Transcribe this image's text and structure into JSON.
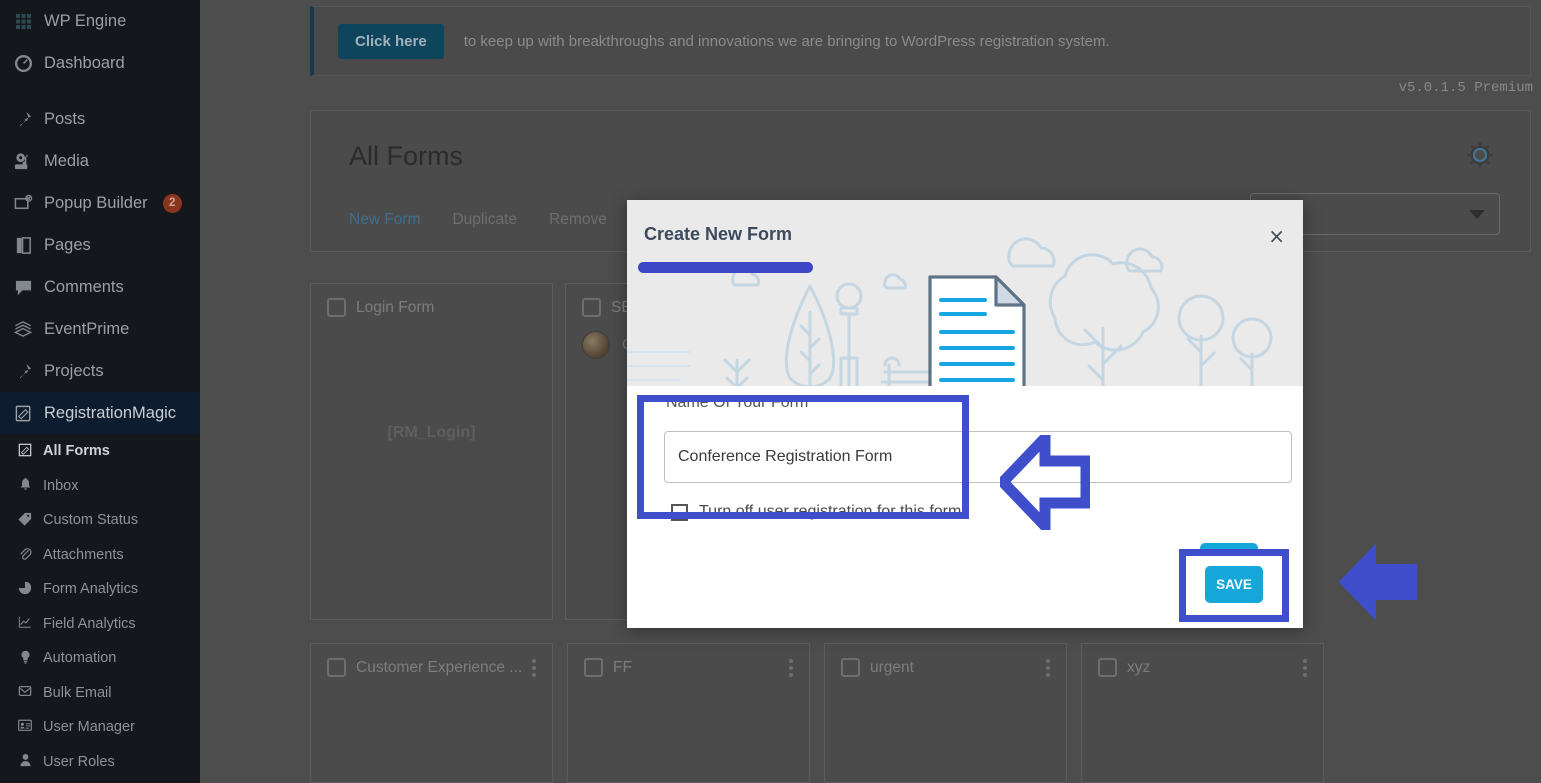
{
  "sidebar": {
    "items": [
      {
        "label": "WP Engine",
        "icon": "wpengine-icon"
      },
      {
        "label": "Dashboard",
        "icon": "dashboard-icon",
        "gap_after": true
      },
      {
        "label": "Posts",
        "icon": "pin-icon"
      },
      {
        "label": "Media",
        "icon": "media-icon"
      },
      {
        "label": "Popup Builder",
        "icon": "popup-icon",
        "badge": "2"
      },
      {
        "label": "Pages",
        "icon": "pages-icon"
      },
      {
        "label": "Comments",
        "icon": "comments-icon"
      },
      {
        "label": "EventPrime",
        "icon": "eventprime-icon"
      },
      {
        "label": "Projects",
        "icon": "pin-icon"
      }
    ],
    "active": {
      "label": "RegistrationMagic",
      "icon": "registrationmagic-icon"
    },
    "submenu": [
      {
        "label": "All Forms",
        "icon": "forms-icon",
        "current": true
      },
      {
        "label": "Inbox",
        "icon": "bell-icon"
      },
      {
        "label": "Custom Status",
        "icon": "tag-icon"
      },
      {
        "label": "Attachments",
        "icon": "paperclip-icon"
      },
      {
        "label": "Form Analytics",
        "icon": "pie-chart-icon"
      },
      {
        "label": "Field Analytics",
        "icon": "line-chart-icon"
      },
      {
        "label": "Automation",
        "icon": "bulb-icon"
      },
      {
        "label": "Bulk Email",
        "icon": "mail-icon"
      },
      {
        "label": "User Manager",
        "icon": "user-card-icon"
      },
      {
        "label": "User Roles",
        "icon": "user-icon"
      }
    ]
  },
  "notice": {
    "button_label": "Click here",
    "text": "to keep up with breakthroughs and innovations we are bringing to WordPress registration system."
  },
  "version": "v5.0.1.5 Premium",
  "panel": {
    "title": "All Forms",
    "gear_icon": "gear-icon",
    "tabs": [
      {
        "label": "New Form",
        "selected": true
      },
      {
        "label": "Duplicate",
        "selected": false
      },
      {
        "label": "Remove",
        "selected": false
      }
    ],
    "filter_placeholder": ""
  },
  "cards": {
    "row1": [
      {
        "name": "Login Form",
        "shortcode": "[RM_Login]",
        "has_avatar": false
      },
      {
        "name": "SEO",
        "shortcode": "[",
        "has_avatar": true,
        "avatar_name": "O"
      }
    ],
    "row2": [
      {
        "name": "Customer Experience ..."
      },
      {
        "name": "FF"
      },
      {
        "name": "urgent"
      },
      {
        "name": "xyz"
      }
    ]
  },
  "modal": {
    "title": "Create New Form",
    "close_label": "×",
    "field_label": "Name Of Your Form",
    "form_name_value": "Conference Registration Form",
    "form_name_placeholder": "Name Of Your Form",
    "checkbox_label": "Turn off user registration for this form",
    "checkbox_checked": false,
    "save_label": "SAVE"
  },
  "colors": {
    "annotation_blue": "#3f4ecb",
    "save_button": "#15a6da",
    "sidebar_bg": "#14171c",
    "sidebar_active": "#0d1c2e",
    "notice_accent": "#16394d",
    "modal_head_bg": "#eaeaea"
  }
}
